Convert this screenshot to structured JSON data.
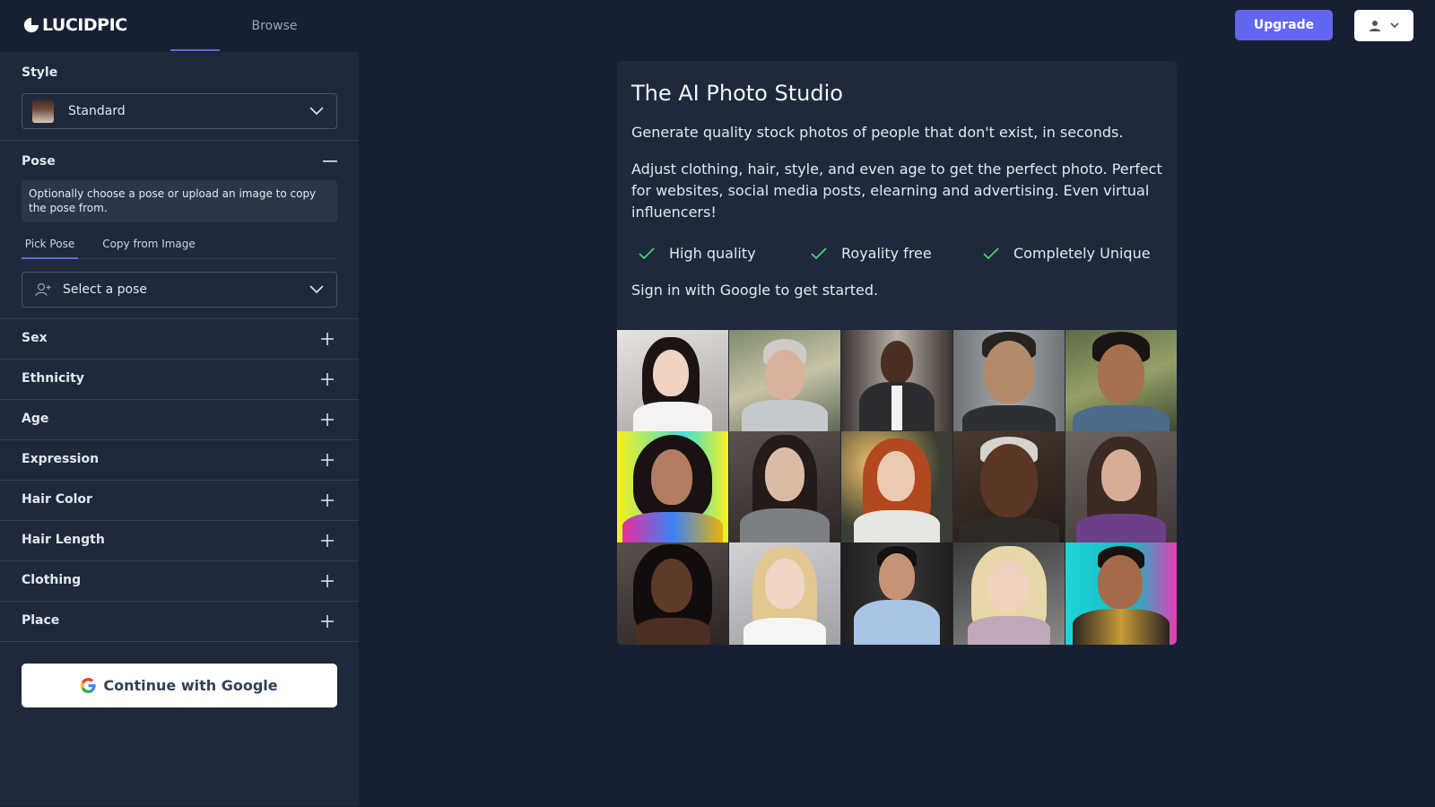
{
  "header": {
    "logo_text": "LUCIDPIC",
    "nav": {
      "browse_label": "Browse"
    },
    "upgrade_label": "Upgrade"
  },
  "sidebar": {
    "style": {
      "label": "Style",
      "value": "Standard"
    },
    "pose": {
      "label": "Pose",
      "info": "Optionally choose a pose or upload an image to copy the pose from.",
      "tabs": [
        "Pick Pose",
        "Copy from Image"
      ],
      "select_placeholder": "Select a pose"
    },
    "sections": [
      "Sex",
      "Ethnicity",
      "Age",
      "Expression",
      "Hair Color",
      "Hair Length",
      "Clothing",
      "Place"
    ],
    "google_button": "Continue with Google"
  },
  "main": {
    "title": "The AI Photo Studio",
    "subtitle": "Generate quality stock photos of people that don't exist, in seconds.",
    "description": "Adjust clothing, hair, style, and even age to get the perfect photo. Perfect for websites, social media posts, elearning and advertising. Even virtual influencers!",
    "features": [
      "High quality",
      "Royality free",
      "Completely Unique"
    ],
    "cta": "Sign in with Google to get started."
  },
  "colors": {
    "accent": "#6366f1",
    "background": "#172033",
    "panel": "#1e293b",
    "check": "#4ade80"
  }
}
